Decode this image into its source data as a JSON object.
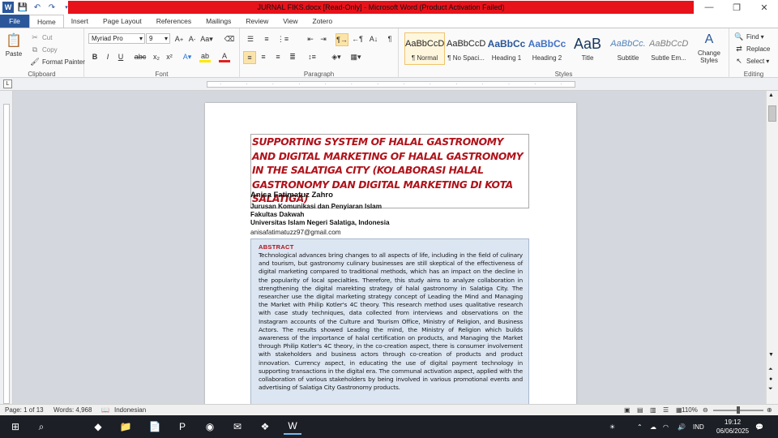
{
  "window": {
    "title": "JURNAL FIKS.docx [Read-Only] - Microsoft Word (Product Activation Failed)"
  },
  "tabs": [
    "File",
    "Home",
    "Insert",
    "Page Layout",
    "References",
    "Mailings",
    "Review",
    "View",
    "Zotero"
  ],
  "clipboard": {
    "paste": "Paste",
    "cut": "Cut",
    "copy": "Copy",
    "format_painter": "Format Painter",
    "label": "Clipboard"
  },
  "font": {
    "name": "Myriad Pro",
    "size": "9",
    "label": "Font",
    "bold": "B",
    "italic": "I",
    "underline": "U",
    "strike": "abc",
    "sub": "x₂",
    "sup": "x²"
  },
  "paragraph": {
    "label": "Paragraph"
  },
  "styles": {
    "label": "Styles",
    "items": [
      {
        "preview": "AaBbCcDc",
        "name": "¶ Normal"
      },
      {
        "preview": "AaBbCcDc",
        "name": "¶ No Spaci..."
      },
      {
        "preview": "AaBbCc",
        "name": "Heading 1"
      },
      {
        "preview": "AaBbCc",
        "name": "Heading 2"
      },
      {
        "preview": "AaB",
        "name": "Title"
      },
      {
        "preview": "AaBbCc.",
        "name": "Subtitle"
      },
      {
        "preview": "AaBbCcDı",
        "name": "Subtle Em..."
      }
    ],
    "change": "Change Styles"
  },
  "editing": {
    "find": "Find",
    "replace": "Replace",
    "select": "Select",
    "label": "Editing"
  },
  "doc": {
    "title": "SUPPORTING SYSTEM OF HALAL GASTRONOMY AND DIGITAL MARKETING  OF HALAL GASTRONOMY IN THE SALATIGA CITY (KOLABORASI HALAL GASTRONOMY DAN DIGITAL MARKETING DI KOTA SALATIGA)",
    "author": "Anisa Fatimatuz Zahro",
    "aff1": "Jurusan Komunikasi dan Penyiaran Islam",
    "aff2": "Fakultas Dakwah",
    "aff3": "Universitas Islam Negeri Salatiga, Indonesia",
    "email": "anisafatimatuzz97@gmail.com",
    "abstract_label": "ABSTRACT",
    "abstract": "Technological advances bring changes to all aspects of life, including in the field of culinary and tourism, but gastronomy culinary businesses are still skeptical of the effectiveness of digital marketing compared to traditional methods, which has an impact on the decline in the popularity of local specialties. Therefore, this study aims to analyze collaboration in strengthening the digital marekting strategy of halal gastronomy in Salatiga City. The researcher use the digital marketing strategy concept of Leading the Mind and Managing the Market with Philip Kotler's 4C theory. This research method uses qualitative research with case study techniques, data collected from interviews and observations on the Instagram accounts of the Culture and Tourism Office, Ministry of Religion, and Business Actors. The results showed Leading the mind, the Ministry of Religion which builds awareness of the importance of halal certification on products, and Managing the Market through Philip Kotler's 4C theory, in the co-creation aspect, there is consumer involvement with stakeholders and business actors through co-creation of products and product innovation. Currency aspect, in educating the use of digital payment technology in supporting transactions in the digital era. The communal activation aspect, applied with the collaboration of various stakeholders by being involved in various promotional events and advertising of Salatiga City Gastronomy products."
  },
  "status": {
    "page": "Page: 1 of 13",
    "words": "Words: 4,968",
    "language": "Indonesian",
    "zoom": "110%"
  },
  "taskbar": {
    "lang": "IND",
    "time": "19:12",
    "date": "06/06/2025"
  }
}
